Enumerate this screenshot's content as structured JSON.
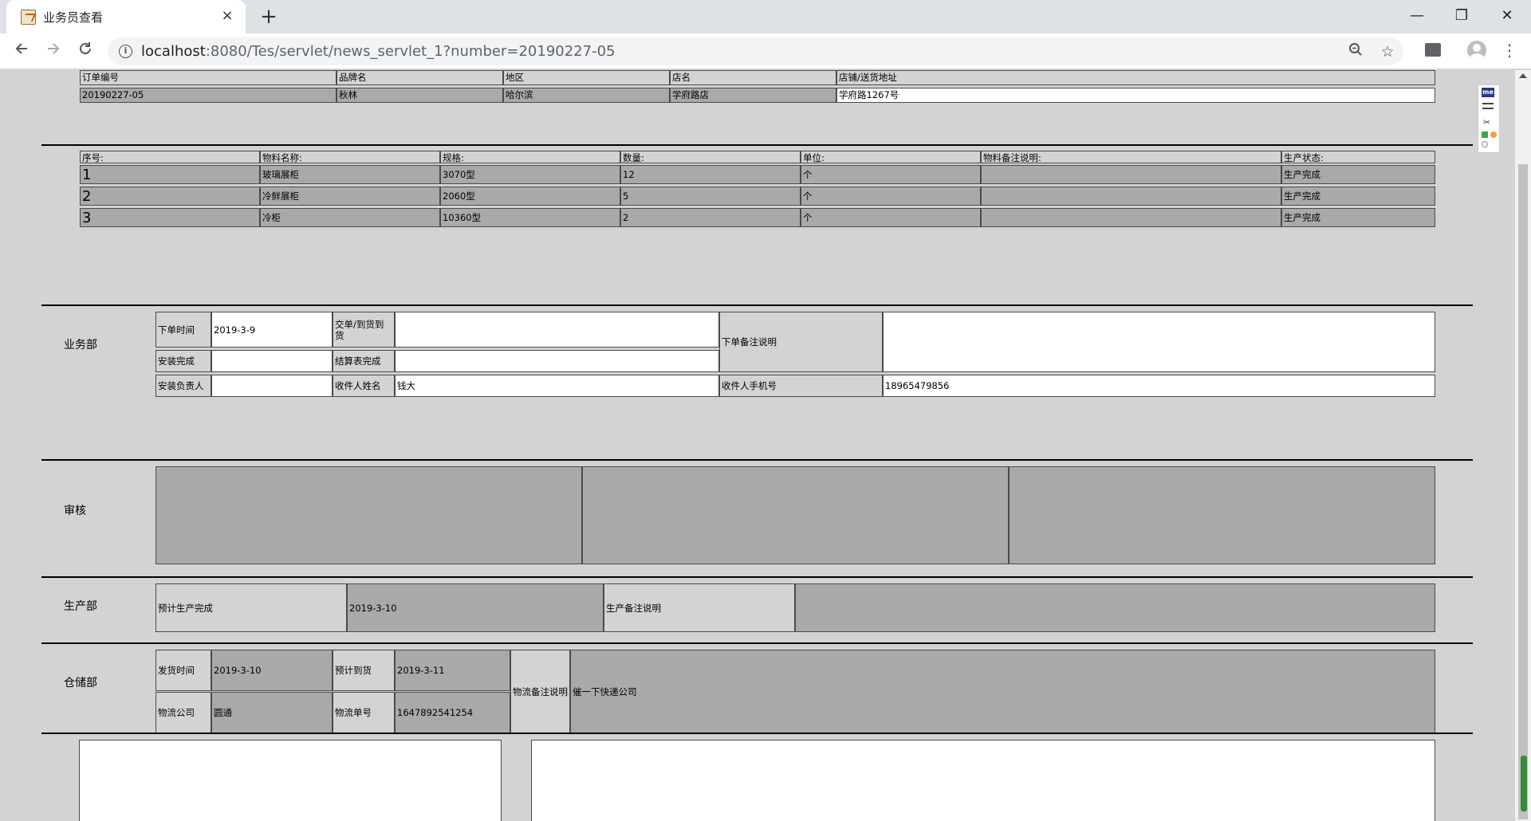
{
  "browser": {
    "tab_title": "业务员查看",
    "tab_close": "×",
    "new_tab": "+",
    "url_host": "localhost",
    "url_rest": ":8080/Tes/servlet/news_servlet_1?number=20190227-05",
    "window_minimize": "—",
    "window_restore": "❐",
    "window_close": "✕",
    "icons": {
      "back": "arrow-left-icon",
      "forward": "arrow-right-icon",
      "reload": "reload-icon",
      "info": "info-icon",
      "zoom": "zoom-icon",
      "star": "star-icon",
      "extension": "extension-icon",
      "profile": "avatar-icon",
      "menu": "more-vert-icon"
    }
  },
  "order": {
    "headers": [
      "订单编号",
      "品牌名",
      "地区",
      "店名",
      "店铺/送货地址"
    ],
    "values": [
      "20190227-05",
      "秋林",
      "哈尔滨",
      "学府路店",
      "学府路1267号"
    ]
  },
  "materials": {
    "headers": [
      "序号:",
      "物料名称:",
      "规格:",
      "数量:",
      "单位:",
      "物料备注说明:",
      "生产状态:"
    ],
    "rows": [
      [
        "1",
        "玻璃展柜",
        "3070型",
        "12",
        "个",
        "",
        "生产完成"
      ],
      [
        "2",
        "冷鲜展柜",
        "2060型",
        "5",
        "个",
        "",
        "生产完成"
      ],
      [
        "3",
        "冷柜",
        "10360型",
        "2",
        "个",
        "",
        "生产完成"
      ]
    ]
  },
  "sales": {
    "dept": "业务部",
    "order_time_label": "下单时间",
    "order_time": "2019-3-9",
    "deliver_label": "交单/到货到货",
    "deliver_value": "",
    "remark_label": "下单备注说明",
    "remark_value": "",
    "install_done_label": "安装完成",
    "install_done_value": "",
    "settle_label": "结算表完成",
    "settle_value": "",
    "installer_label": "安装负责人",
    "installer_value": "",
    "recipient_label": "收件人姓名",
    "recipient_value": "钱大",
    "phone_label": "收件人手机号",
    "phone_value": "18965479856"
  },
  "audit": {
    "dept": "审核"
  },
  "production": {
    "dept": "生产部",
    "expected_label": "预计生产完成",
    "expected_value": "2019-3-10",
    "remark_label": "生产备注说明",
    "remark_value": ""
  },
  "warehouse": {
    "dept": "仓储部",
    "ship_time_label": "发货时间",
    "ship_time": "2019-3-10",
    "eta_label": "预计到货",
    "eta": "2019-3-11",
    "remark_label": "物流备注说明",
    "remark_value": "催一下快递公司",
    "company_label": "物流公司",
    "company": "圆通",
    "tracking_label": "物流单号",
    "tracking": "1647892541254"
  },
  "extension": {
    "badge": "me"
  }
}
